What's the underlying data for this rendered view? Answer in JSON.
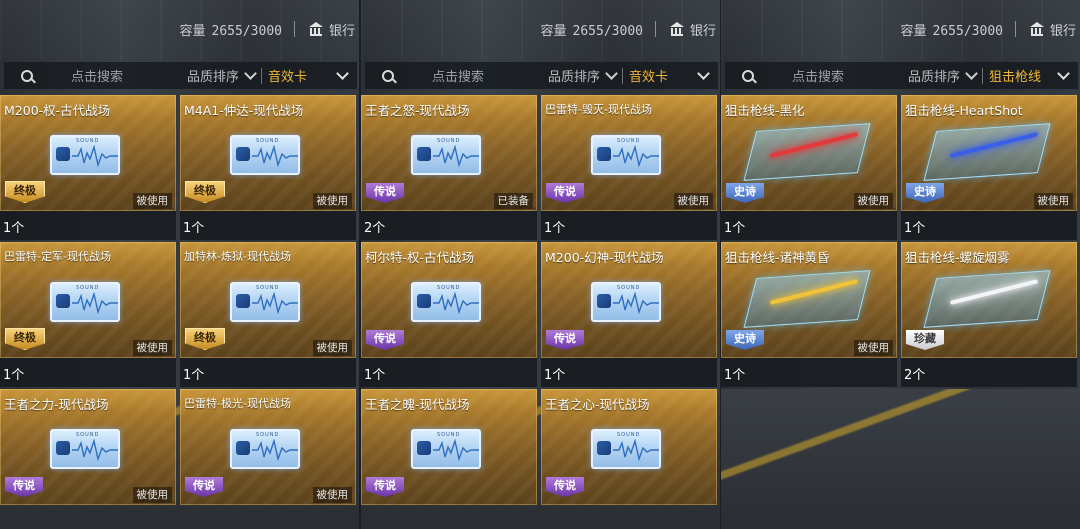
{
  "panels": [
    {
      "capacity_label": "容量",
      "capacity_value": "2655/3000",
      "bank_label": "银行",
      "search_placeholder": "点击搜索",
      "sort_label": "品质排序",
      "filter_label": "音效卡",
      "items": [
        {
          "title": "M200-权-古代战场",
          "rarity": "终极",
          "status": "被使用",
          "qty": "1个",
          "kind": "sound"
        },
        {
          "title": "M4A1-仲达-现代战场",
          "rarity": "终极",
          "status": "被使用",
          "qty": "1个",
          "kind": "sound"
        },
        {
          "title": "巴雷特-定军-现代战场",
          "rarity": "终极",
          "status": "被使用",
          "qty": "1个",
          "kind": "sound"
        },
        {
          "title": "加特林-炼狱-现代战场",
          "rarity": "终极",
          "status": "被使用",
          "qty": "1个",
          "kind": "sound"
        },
        {
          "title": "王者之力-现代战场",
          "rarity": "传说",
          "status": "被使用",
          "qty": "",
          "kind": "sound"
        },
        {
          "title": "巴雷特-极光-现代战场",
          "rarity": "传说",
          "status": "被使用",
          "qty": "",
          "kind": "sound"
        }
      ]
    },
    {
      "capacity_label": "容量",
      "capacity_value": "2655/3000",
      "bank_label": "银行",
      "search_placeholder": "点击搜索",
      "sort_label": "品质排序",
      "filter_label": "音效卡",
      "items": [
        {
          "title": "王者之怒-现代战场",
          "rarity": "传说",
          "status": "已装备",
          "qty": "2个",
          "kind": "sound"
        },
        {
          "title": "巴雷特-毁灭-现代战场",
          "rarity": "传说",
          "status": "被使用",
          "qty": "1个",
          "kind": "sound"
        },
        {
          "title": "柯尔特-权-古代战场",
          "rarity": "传说",
          "status": "",
          "qty": "1个",
          "kind": "sound"
        },
        {
          "title": "M200-幻神-现代战场",
          "rarity": "传说",
          "status": "",
          "qty": "1个",
          "kind": "sound"
        },
        {
          "title": "王者之魄-现代战场",
          "rarity": "传说",
          "status": "",
          "qty": "",
          "kind": "sound"
        },
        {
          "title": "王者之心-现代战场",
          "rarity": "传说",
          "status": "",
          "qty": "",
          "kind": "sound"
        }
      ]
    },
    {
      "capacity_label": "容量",
      "capacity_value": "2655/3000",
      "bank_label": "银行",
      "search_placeholder": "点击搜索",
      "sort_label": "品质排序",
      "filter_label": "狙击枪线",
      "items": [
        {
          "title": "狙击枪线-黑化",
          "rarity": "史诗",
          "status": "被使用",
          "qty": "1个",
          "kind": "beam",
          "beam_color": "#e23a3a"
        },
        {
          "title": "狙击枪线-HeartShot",
          "rarity": "史诗",
          "status": "被使用",
          "qty": "1个",
          "kind": "beam",
          "beam_color": "#3a5ee8"
        },
        {
          "title": "狙击枪线-诸神黄昏",
          "rarity": "史诗",
          "status": "被使用",
          "qty": "1个",
          "kind": "beam",
          "beam_color": "#f2c23a"
        },
        {
          "title": "狙击枪线-螺旋烟雾",
          "rarity": "珍藏",
          "status": "",
          "qty": "2个",
          "kind": "beam",
          "beam_color": "#f2f4f8"
        }
      ]
    }
  ],
  "colors": {
    "accent": "#f0b63a",
    "card_gold": "#a97a2c",
    "rarity_ultimate": "#e0a83a",
    "rarity_legend": "#8a4fc4",
    "rarity_epic": "#5a80cf",
    "rarity_rare": "#e6e6e6"
  }
}
